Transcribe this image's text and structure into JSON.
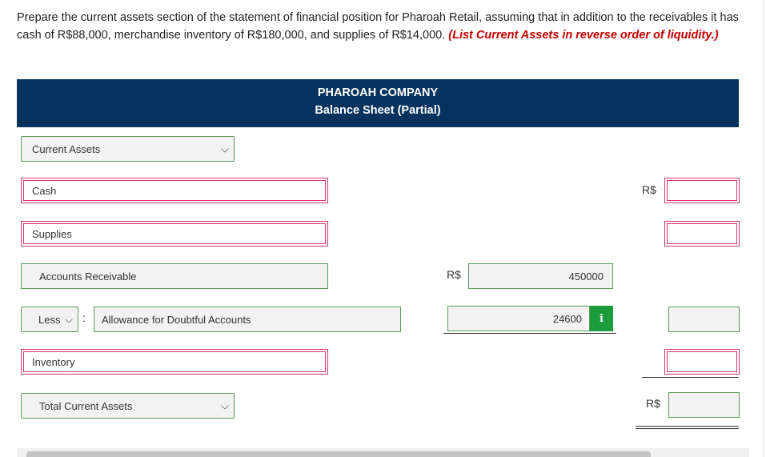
{
  "instructions": {
    "text": "Prepare the current assets section of the statement of financial position for Pharoah Retail, assuming that in addition to the receivables it has cash of R$88,000, merchandise inventory of R$180,000, and supplies of R$14,000.",
    "emphasis": "(List Current Assets in reverse order of liquidity.)"
  },
  "header": {
    "company": "PHAROAH COMPANY",
    "statement": "Balance Sheet (Partial)"
  },
  "rows": {
    "section_select": "Current Assets",
    "cash": "Cash",
    "supplies": "Supplies",
    "accounts_receivable": "Accounts Receivable",
    "ar_value": "450000",
    "less_select": "Less",
    "allowance": "Allowance for Doubtful Accounts",
    "allowance_value": "24600",
    "inventory": "Inventory",
    "total_select": "Total Current Assets"
  },
  "currency": {
    "symbol_cash": "R$",
    "symbol_ar": "R$",
    "symbol_total": "R$"
  },
  "icons": {
    "info": "i",
    "chevron": "chevron-down-icon",
    "colon": ":"
  },
  "colors": {
    "header_bg": "#06325e",
    "error_border": "#d6336c",
    "ok_border": "#5d9b5d",
    "info_bg": "#1b9b3a",
    "emphasis": "#c40000"
  }
}
